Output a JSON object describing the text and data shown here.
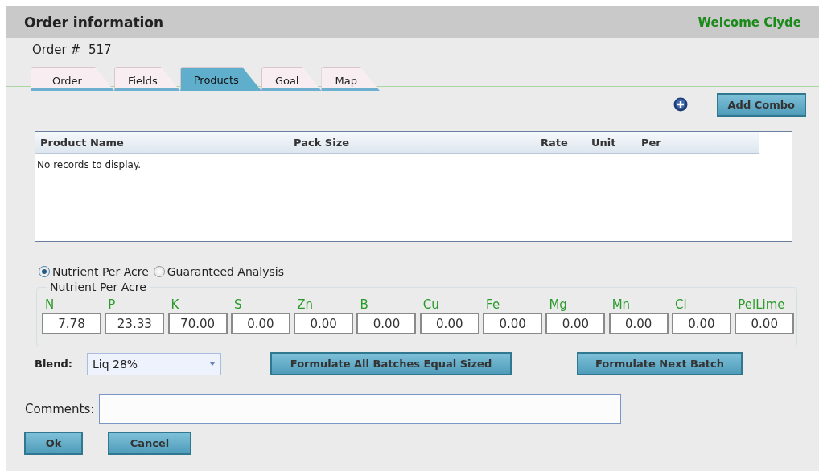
{
  "header": {
    "title": "Order information",
    "welcome": "Welcome Clyde"
  },
  "order_number": {
    "label": "Order #",
    "value": "517"
  },
  "tabs": [
    {
      "label": "Order",
      "selected": false
    },
    {
      "label": "Fields",
      "selected": false
    },
    {
      "label": "Products",
      "selected": true
    },
    {
      "label": "Goal",
      "selected": false
    },
    {
      "label": "Map",
      "selected": false
    }
  ],
  "add_combo": {
    "label": "Add Combo"
  },
  "table": {
    "columns": [
      "Product Name",
      "Pack Size",
      "Rate",
      "Unit",
      "Per"
    ],
    "empty_message": "No records to display."
  },
  "mode_options": [
    {
      "label": "Nutrient Per Acre",
      "selected": true
    },
    {
      "label": "Guaranteed Analysis",
      "selected": false
    }
  ],
  "nutrients": {
    "legend": "Nutrient Per Acre",
    "items": [
      {
        "name": "N",
        "value": "7.78"
      },
      {
        "name": "P",
        "value": "23.33"
      },
      {
        "name": "K",
        "value": "70.00"
      },
      {
        "name": "S",
        "value": "0.00"
      },
      {
        "name": "Zn",
        "value": "0.00"
      },
      {
        "name": "B",
        "value": "0.00"
      },
      {
        "name": "Cu",
        "value": "0.00"
      },
      {
        "name": "Fe",
        "value": "0.00"
      },
      {
        "name": "Mg",
        "value": "0.00"
      },
      {
        "name": "Mn",
        "value": "0.00"
      },
      {
        "name": "Cl",
        "value": "0.00"
      },
      {
        "name": "PelLime",
        "value": "0.00"
      }
    ]
  },
  "blend": {
    "label": "Blend:",
    "value": "Liq 28%"
  },
  "formulate_buttons": [
    "Formulate All Batches Equal Sized",
    "Formulate Next Batch"
  ],
  "comments": {
    "label": "Comments:"
  },
  "buttons": [
    "Ok",
    "Cancel"
  ]
}
